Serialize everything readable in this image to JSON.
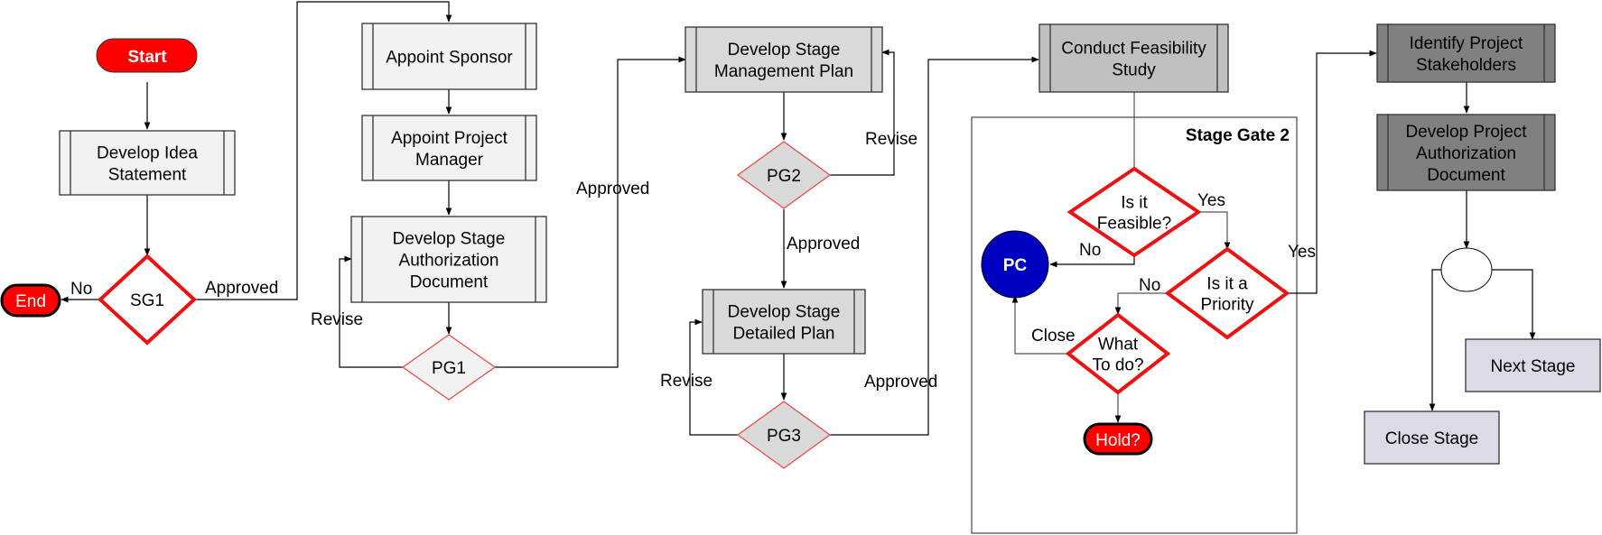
{
  "diagram": {
    "colors": {
      "terminal_red": "#ff0000",
      "decision_red": "#ee1111",
      "process_light": "#f2f2f2",
      "process_mid": "#d9d9d9",
      "process_gray": "#c0c0c0",
      "process_dark": "#808080",
      "stage_lilac": "#ddd9e6",
      "connector_blue": "#0000c0"
    },
    "terminals": {
      "start": "Start",
      "end": "End",
      "hold": "Hold?"
    },
    "processes": {
      "develop_idea": [
        "Develop Idea",
        "Statement"
      ],
      "appoint_sponsor": [
        "Appoint Sponsor"
      ],
      "appoint_pm": [
        "Appoint Project",
        "Manager"
      ],
      "stage_auth_doc": [
        "Develop Stage",
        "Authorization",
        "Document"
      ],
      "stage_mgmt_plan": [
        "Develop Stage",
        "Management Plan"
      ],
      "stage_detailed_plan": [
        "Develop Stage",
        "Detailed Plan"
      ],
      "feasibility_study": [
        "Conduct Feasibility",
        "Study"
      ],
      "identify_stakeholders": [
        "Identify Project",
        "Stakeholders"
      ],
      "project_auth_doc": [
        "Develop Project",
        "Authorization",
        "Document"
      ],
      "next_stage": [
        "Next Stage"
      ],
      "close_stage": [
        "Close  Stage"
      ]
    },
    "decisions": {
      "sg1": [
        "SG1"
      ],
      "pg1": [
        "PG1"
      ],
      "pg2": [
        "PG2"
      ],
      "pg3": [
        "PG3"
      ],
      "feasible": [
        "Is it",
        "Feasible?"
      ],
      "priority": [
        "Is it a",
        "Priority"
      ],
      "what_to_do": [
        "What",
        "To do?"
      ]
    },
    "connectors": {
      "pc": "PC"
    },
    "group": {
      "stage_gate_title": "Stage Gate 2"
    },
    "edge_labels": {
      "sg1_no": "No",
      "sg1_approved": "Approved",
      "pg1_revise": "Revise",
      "pg1_approved": "Approved",
      "pg2_revise": "Revise",
      "pg2_approved": "Approved",
      "pg3_revise": "Revise",
      "pg3_approved": "Approved",
      "feasible_yes": "Yes",
      "feasible_no": "No",
      "priority_no": "No",
      "priority_yes": "Yes",
      "what_close": "Close"
    }
  }
}
